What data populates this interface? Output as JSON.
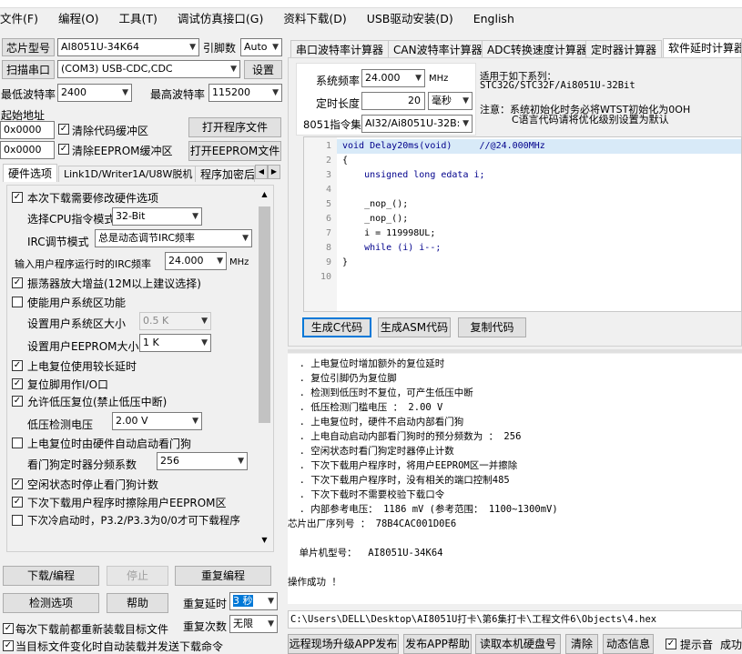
{
  "menu": [
    "文件(F)",
    "编程(O)",
    "工具(T)",
    "调试仿真接口(G)",
    "资料下载(D)",
    "USB驱动安装(D)",
    "English"
  ],
  "left": {
    "chip_label": "芯片型号",
    "chip_value": "AI8051U-34K64",
    "pin_label": "引脚数",
    "pin_value": "Auto",
    "scan_btn": "扫描串口",
    "port_value": "(COM3) USB-CDC,CDC",
    "settings_btn": "设置",
    "min_baud_label": "最低波特率",
    "min_baud_value": "2400",
    "max_baud_label": "最高波特率",
    "max_baud_value": "115200",
    "start_addr_label": "起始地址",
    "addr1": "0x0000",
    "clear_code": "清除代码缓冲区",
    "open_prog": "打开程序文件",
    "addr2": "0x0000",
    "clear_eeprom": "清除EEPROM缓冲区",
    "open_eeprom": "打开EEPROM文件",
    "tabs": [
      "硬件选项",
      "Link1D/Writer1A/U8W脱机",
      "程序加密后"
    ],
    "opt_modify_hw": "本次下载需要修改硬件选项",
    "opt_cpu_label": "选择CPU指令模式",
    "opt_cpu_value": "32-Bit",
    "opt_irc_label": "IRC调节模式",
    "opt_irc_value": "总是动态调节IRC频率",
    "opt_freq_label": "输入用户程序运行时的IRC频率",
    "opt_freq_value": "24.000",
    "opt_freq_unit": "MHz",
    "opt_osc_gain": "振荡器放大增益(12M以上建议选择)",
    "opt_user_sys": "使能用户系统区功能",
    "opt_sys_size_label": "设置用户系统区大小",
    "opt_sys_size_value": "0.5 K",
    "opt_eeprom_size_label": "设置用户EEPROM大小",
    "opt_eeprom_size_value": "1   K",
    "opt_long_reset": "上电复位使用较长延时",
    "opt_reset_io": "复位脚用作I/O口",
    "opt_lvr": "允许低压复位(禁止低压中断)",
    "opt_lv_label": "低压检测电压",
    "opt_lv_value": "2.00 V",
    "opt_wdt_hw": "上电复位时由硬件自动启动看门狗",
    "opt_wdt_div_label": "看门狗定时器分频系数",
    "opt_wdt_div_value": "256",
    "opt_idle_wdt": "空闲状态时停止看门狗计数",
    "opt_erase_eeprom": "下次下载用户程序时擦除用户EEPROM区",
    "opt_cold_boot": "下次冷启动时，P3.2/P3.3为0/0才可下载程序",
    "btn_download": "下载/编程",
    "btn_stop": "停止",
    "btn_reprogram": "重复编程",
    "btn_check": "检测选项",
    "btn_help": "帮助",
    "delay_label": "重复延时",
    "delay_value": "3 秒",
    "count_label": "重复次数",
    "count_value": "无限",
    "reload_label": "每次下载前都重新装载目标文件",
    "auto_send_label": "当目标文件变化时自动装载并发送下载命令"
  },
  "right": {
    "tabs": [
      "串口波特率计算器",
      "CAN波特率计算器",
      "ADC转换速度计算器",
      "定时器计算器",
      "软件延时计算器"
    ],
    "sys_freq_label": "系统频率",
    "sys_freq_value": "24.000",
    "sys_freq_unit": "MHz",
    "delay_len_label": "定时长度",
    "delay_len_value": "20",
    "delay_len_unit": "毫秒",
    "isa_label": "8051指令集",
    "isa_value": "AI32/Ai8051U-32B:",
    "note1": "适用于如下系列：",
    "note2": "STC32G/STC32F/Ai8051U-32Bit",
    "note3": "注意：系统初始化时务必将WTST初始化为0OH",
    "note4": "C语言代码请将优化级别设置为默认",
    "code": [
      {
        "n": "1",
        "t": "void Delay20ms(void)     //@24.000MHz"
      },
      {
        "n": "2",
        "t": "{"
      },
      {
        "n": "3",
        "t": "    unsigned long edata i;"
      },
      {
        "n": "4",
        "t": ""
      },
      {
        "n": "5",
        "t": "    _nop_();"
      },
      {
        "n": "6",
        "t": "    _nop_();"
      },
      {
        "n": "7",
        "t": "    i = 119998UL;"
      },
      {
        "n": "8",
        "t": "    while (i) i--;"
      },
      {
        "n": "9",
        "t": "}"
      },
      {
        "n": "10",
        "t": ""
      }
    ],
    "btn_gen_c": "生成C代码",
    "btn_gen_asm": "生成ASM代码",
    "btn_copy": "复制代码",
    "log": [
      "  . 上电复位时增加额外的复位延时",
      "  . 复位引脚仍为复位脚",
      "  . 检测到低压时不复位，可产生低压中断",
      "  . 低压检测门槛电压 ： 2.00 V",
      "  . 上电复位时，硬件不启动内部看门狗",
      "  . 上电自动启动内部看门狗时的预分频数为 ： 256",
      "  . 空闲状态时看门狗定时器停止计数",
      "  . 下次下载用户程序时，将用户EEPROM区一并擦除",
      "  . 下次下载用户程序时，没有相关的端口控制485",
      "  . 下次下载时不需要校验下载口令",
      "  . 内部参考电压： 1186 mV (参考范围： 1100~1300mV)",
      "芯片出厂序列号 ： 78B4CAC001D0E6",
      "",
      "  单片机型号：  AI8051U-34K64",
      "",
      "操作成功 ！"
    ],
    "path": "C:\\Users\\DELL\\Desktop\\AI8051U打卡\\第6集打卡\\工程文件6\\Objects\\4.hex",
    "bottom_btns": [
      "远程现场升级APP发布",
      "发布APP帮助",
      "读取本机硬盘号",
      "清除",
      "动态信息"
    ],
    "beep_label": "提示音",
    "success_label": "成功"
  }
}
